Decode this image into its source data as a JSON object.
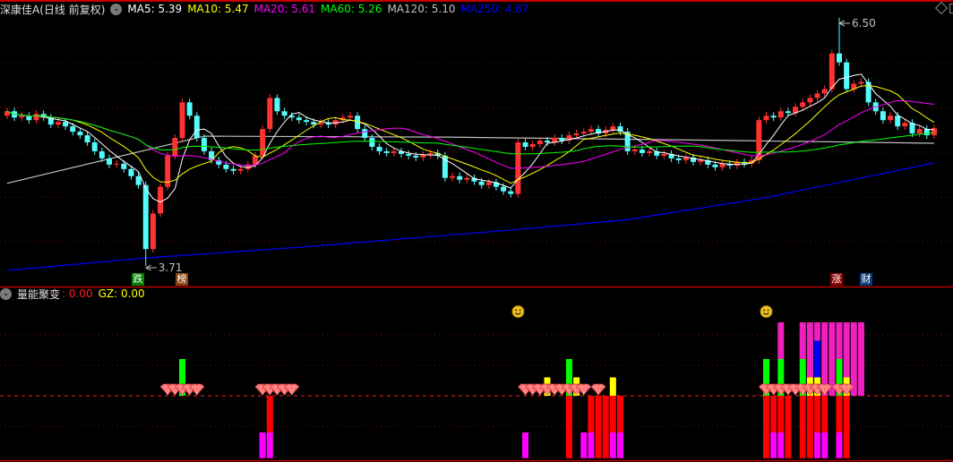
{
  "header": {
    "title": "深康佳A",
    "mode": "(日线 前复权)",
    "ma": [
      {
        "label": "MA5: 5.39",
        "color": "#ffffff"
      },
      {
        "label": "MA10: 5.47",
        "color": "#ffff00"
      },
      {
        "label": "MA20: 5.61",
        "color": "#ff00ff"
      },
      {
        "label": "MA60: 5.26",
        "color": "#00ff00"
      },
      {
        "label": "MA120: 5.10",
        "color": "#c0c0c0"
      },
      {
        "label": "MA250: 4.87",
        "color": "#0000ff"
      }
    ]
  },
  "indicator_header": {
    "name": "量能聚变",
    "value": ": 0.00",
    "gz": "GZ: 0.00"
  },
  "signals": [
    {
      "text": "跌",
      "color": "#008000"
    },
    {
      "text": "榜",
      "color": "#8b4513"
    },
    {
      "text": "涨",
      "color": "#8b0000"
    },
    {
      "text": "财",
      "color": "#0a3c78"
    }
  ],
  "chart_data": [
    {
      "type": "candlestick",
      "title": "深康佳A (日线 前复权)",
      "ylim": [
        3.6,
        6.5
      ],
      "up_color": "#ff3232",
      "down_color": "#54fcfc",
      "closes": [
        5.45,
        5.38,
        5.4,
        5.35,
        5.42,
        5.38,
        5.3,
        5.33,
        5.28,
        5.22,
        5.18,
        5.1,
        5.0,
        4.92,
        4.85,
        4.86,
        4.8,
        4.72,
        4.62,
        3.9,
        4.3,
        4.6,
        4.95,
        5.15,
        5.55,
        5.4,
        5.15,
        5.0,
        4.9,
        4.85,
        4.8,
        4.78,
        4.8,
        4.85,
        4.95,
        5.25,
        5.6,
        5.45,
        5.4,
        5.38,
        5.35,
        5.33,
        5.3,
        5.32,
        5.3,
        5.35,
        5.38,
        5.4,
        5.25,
        5.15,
        5.05,
        5.0,
        4.98,
        5.0,
        4.97,
        4.95,
        4.93,
        4.96,
        4.98,
        4.95,
        4.7,
        4.72,
        4.68,
        4.7,
        4.66,
        4.62,
        4.65,
        4.6,
        4.55,
        4.52,
        5.1,
        5.05,
        5.08,
        5.12,
        5.1,
        5.15,
        5.12,
        5.18,
        5.2,
        5.22,
        5.25,
        5.2,
        5.24,
        5.28,
        5.22,
        5.0,
        5.02,
        4.98,
        5.0,
        4.95,
        4.97,
        4.92,
        4.9,
        4.93,
        4.88,
        4.9,
        4.85,
        4.82,
        4.86,
        4.84,
        4.88,
        4.86,
        4.9,
        5.35,
        5.4,
        5.38,
        5.45,
        5.43,
        5.5,
        5.55,
        5.6,
        5.65,
        5.7,
        6.1,
        6.0,
        5.7,
        5.76,
        5.78,
        5.55,
        5.45,
        5.35,
        5.4,
        5.28,
        5.32,
        5.2,
        5.25,
        5.18,
        5.26
      ],
      "first_open": 5.4,
      "extremes": {
        "max": {
          "index": 114,
          "price": 6.5,
          "label": "6.50"
        },
        "min": {
          "index": 19,
          "price": 3.71,
          "label": "3.71"
        }
      },
      "moving_averages": [
        {
          "name": "MA5",
          "period": 5,
          "color": "#ffffff"
        },
        {
          "name": "MA10",
          "period": 10,
          "color": "#ffff00"
        },
        {
          "name": "MA20",
          "period": 20,
          "color": "#ff00ff"
        },
        {
          "name": "MA60",
          "period": 60,
          "color": "#00ff00"
        }
      ],
      "long_averages": [
        {
          "name": "MA120",
          "color": "#c0c0c0",
          "points": [
            [
              0,
              4.64
            ],
            [
              27,
              5.17
            ],
            [
              60,
              5.16
            ],
            [
              100,
              5.12
            ],
            [
              127,
              5.09
            ]
          ]
        },
        {
          "name": "MA250",
          "color": "#0000ff",
          "points": [
            [
              0,
              3.66
            ],
            [
              19,
              3.8
            ],
            [
              40,
              3.92
            ],
            [
              70,
              4.12
            ],
            [
              85,
              4.23
            ],
            [
              104,
              4.48
            ],
            [
              127,
              4.87
            ]
          ]
        }
      ],
      "signal_indices": [
        18,
        24,
        113,
        117
      ]
    },
    {
      "type": "bar",
      "title": "量能聚变",
      "ylim": [
        -3.6,
        4.2
      ],
      "reference_line": 0,
      "colors": {
        "G": "#00ff00",
        "Y": "#ffff00",
        "P": "#f020c0",
        "B": "#0000ff",
        "R": "#ff0000",
        "M": "#ff00ff"
      },
      "bars": [
        {
          "i": 24,
          "up": "G2",
          "down": ""
        },
        {
          "i": 35,
          "up": "",
          "down": "N2|M3.4"
        },
        {
          "i": 36,
          "up": "",
          "down": "R2|M3.4"
        },
        {
          "i": 71,
          "up": "",
          "down": "N2|M3.4"
        },
        {
          "i": 74,
          "up": "Y1",
          "down": ""
        },
        {
          "i": 77,
          "up": "G2",
          "down": "R3.4"
        },
        {
          "i": 78,
          "up": "Y1",
          "down": ""
        },
        {
          "i": 79,
          "up": "",
          "down": "N2|M3.4"
        },
        {
          "i": 80,
          "up": "",
          "down": "R2|M3.4"
        },
        {
          "i": 81,
          "up": "",
          "down": "R3.4"
        },
        {
          "i": 82,
          "up": "",
          "down": "R3.4"
        },
        {
          "i": 83,
          "up": "Y1",
          "down": "R2|M3.4"
        },
        {
          "i": 84,
          "up": "",
          "down": "R2|M3.4"
        },
        {
          "i": 104,
          "up": "G2",
          "down": "R3.4"
        },
        {
          "i": 105,
          "up": "",
          "down": "R2|M3.4"
        },
        {
          "i": 106,
          "up": "G2|P4",
          "down": "R2|M3.4"
        },
        {
          "i": 107,
          "up": "",
          "down": "R3.4"
        },
        {
          "i": 109,
          "up": "G2|P4",
          "down": "R3.4"
        },
        {
          "i": 110,
          "up": "Y1|P4",
          "down": "R3.4"
        },
        {
          "i": 111,
          "up": "Y1|B3|P4",
          "down": "R2|M3.4"
        },
        {
          "i": 112,
          "up": "P4",
          "down": "R2|M3.4"
        },
        {
          "i": 113,
          "up": "P4",
          "down": ""
        },
        {
          "i": 114,
          "up": "G2|P4",
          "down": "R2|M3.4"
        },
        {
          "i": 115,
          "up": "Y1|P4",
          "down": "R3.4"
        },
        {
          "i": 116,
          "up": "P4",
          "down": ""
        },
        {
          "i": 117,
          "up": "P4",
          "down": ""
        }
      ],
      "diamond_indices": [
        22,
        23,
        24,
        25,
        26,
        35,
        36,
        37,
        38,
        39,
        71,
        72,
        73,
        74,
        75,
        76,
        77,
        78,
        79,
        81,
        104,
        105,
        106,
        107,
        108,
        109,
        110,
        111,
        112,
        114,
        115
      ],
      "smiley_indices": [
        70,
        104
      ]
    }
  ]
}
